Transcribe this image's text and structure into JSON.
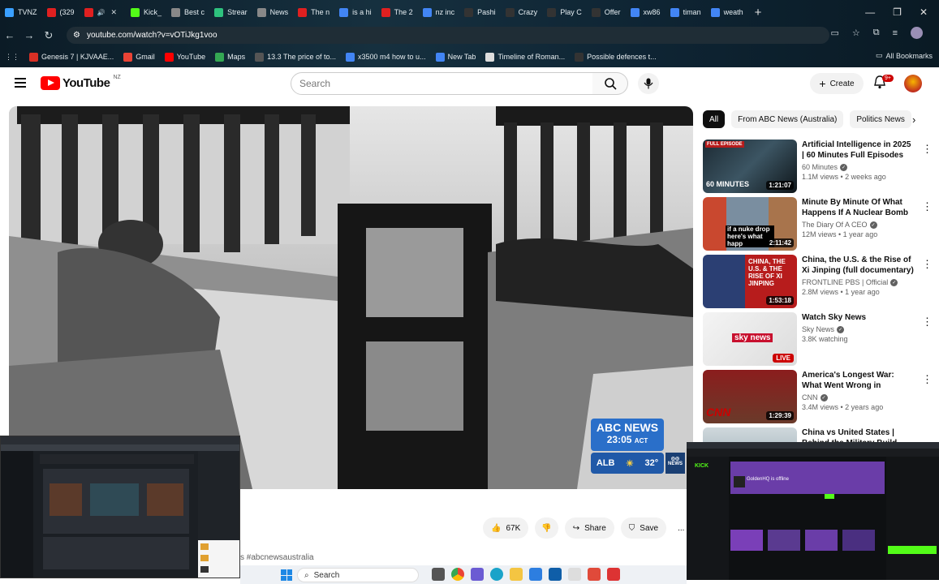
{
  "browser": {
    "tabs": [
      {
        "label": "TVNZ",
        "color": "#3aa0ff"
      },
      {
        "label": "(329",
        "color": "#e02020"
      },
      {
        "label": "",
        "color": "#e02020",
        "audio": true
      },
      {
        "label": "Kick_",
        "color": "#53fc18"
      },
      {
        "label": "Best c",
        "color": "#888888"
      },
      {
        "label": "Strear",
        "color": "#2ec27e"
      },
      {
        "label": "News",
        "color": "#888888"
      },
      {
        "label": "The n",
        "color": "#e02020"
      },
      {
        "label": "is a hi",
        "color": "#4285f4"
      },
      {
        "label": "The 2",
        "color": "#e02020"
      },
      {
        "label": "nz inc",
        "color": "#4285f4"
      },
      {
        "label": "Pashi",
        "color": "#333333"
      },
      {
        "label": "Crazy",
        "color": "#333333"
      },
      {
        "label": "Play C",
        "color": "#333333"
      },
      {
        "label": "Offer",
        "color": "#333333"
      },
      {
        "label": "xw86",
        "color": "#4285f4"
      },
      {
        "label": "timan",
        "color": "#4285f4"
      },
      {
        "label": "weath",
        "color": "#4285f4"
      }
    ],
    "url": "youtube.com/watch?v=vOTiJkg1voo",
    "bookmarks": [
      {
        "label": "Genesis 7 | KJVAAE...",
        "color": "#d93025"
      },
      {
        "label": "Gmail",
        "color": "#ea4335"
      },
      {
        "label": "YouTube",
        "color": "#ff0000"
      },
      {
        "label": "Maps",
        "color": "#34a853"
      },
      {
        "label": "13.3 The price of to...",
        "color": "#555555"
      },
      {
        "label": "x3500 m4 how to u...",
        "color": "#4285f4"
      },
      {
        "label": "New Tab",
        "color": "#4285f4"
      },
      {
        "label": "Timeline of Roman...",
        "color": "#dddddd"
      },
      {
        "label": "Possible defences t...",
        "color": "#333333"
      }
    ],
    "all_bookmarks": "All Bookmarks"
  },
  "youtube": {
    "region": "NZ",
    "logo_text": "YouTube",
    "search_placeholder": "Search",
    "create_label": "Create",
    "notif_badge": "9+",
    "likes": "67K",
    "share_label": "Share",
    "save_label": "Save",
    "more_label": "...",
    "hashtag": "s #abcnewsaustralia",
    "abc": {
      "brand": "ABC NEWS",
      "time": "23:05",
      "tz": "ACT",
      "city": "ALB",
      "temp": "32°",
      "corner": "NEWS"
    },
    "chips": [
      "All",
      "From ABC News (Australia)",
      "Politics News"
    ],
    "recs": [
      {
        "title": "Artificial Intelligence in 2025 | 60 Minutes Full Episodes",
        "channel": "60 Minutes",
        "views": "1.1M views",
        "age": "2 weeks ago",
        "duration": "1:21:07",
        "badge": "FULL EPISODE",
        "overlay": "60 MINUTES"
      },
      {
        "title": "Minute By Minute Of What Happens If A Nuclear Bomb ...",
        "channel": "The Diary Of A CEO",
        "views": "12M views",
        "age": "1 year ago",
        "duration": "2:11:42",
        "overlay": "if a nuke drop here's what happ"
      },
      {
        "title": "China, the U.S. & the Rise of Xi Jinping (full documentary) | ...",
        "channel": "FRONTLINE PBS | Official",
        "views": "2.8M views",
        "age": "1 year ago",
        "duration": "1:53:18",
        "overlay": "CHINA, THE U.S. & THE RISE OF XI JINPING"
      },
      {
        "title": "Watch Sky News",
        "channel": "Sky News",
        "views": "3.8K watching",
        "age": "",
        "duration": "LIVE",
        "overlay": "sky news"
      },
      {
        "title": "America's Longest War: What Went Wrong in Afghanistan ...",
        "channel": "CNN",
        "views": "3.4M views",
        "age": "2 years ago",
        "duration": "1:29:39",
        "overlay": "CNN"
      },
      {
        "title": "China vs United States | Behind the Military Build...",
        "channel": "",
        "views": "",
        "age": "",
        "duration": "",
        "overlay": ""
      }
    ]
  },
  "overlay_right": {
    "label": "KICK",
    "title": "GoldenHQ is offline"
  },
  "taskbar": {
    "search": "Search"
  }
}
